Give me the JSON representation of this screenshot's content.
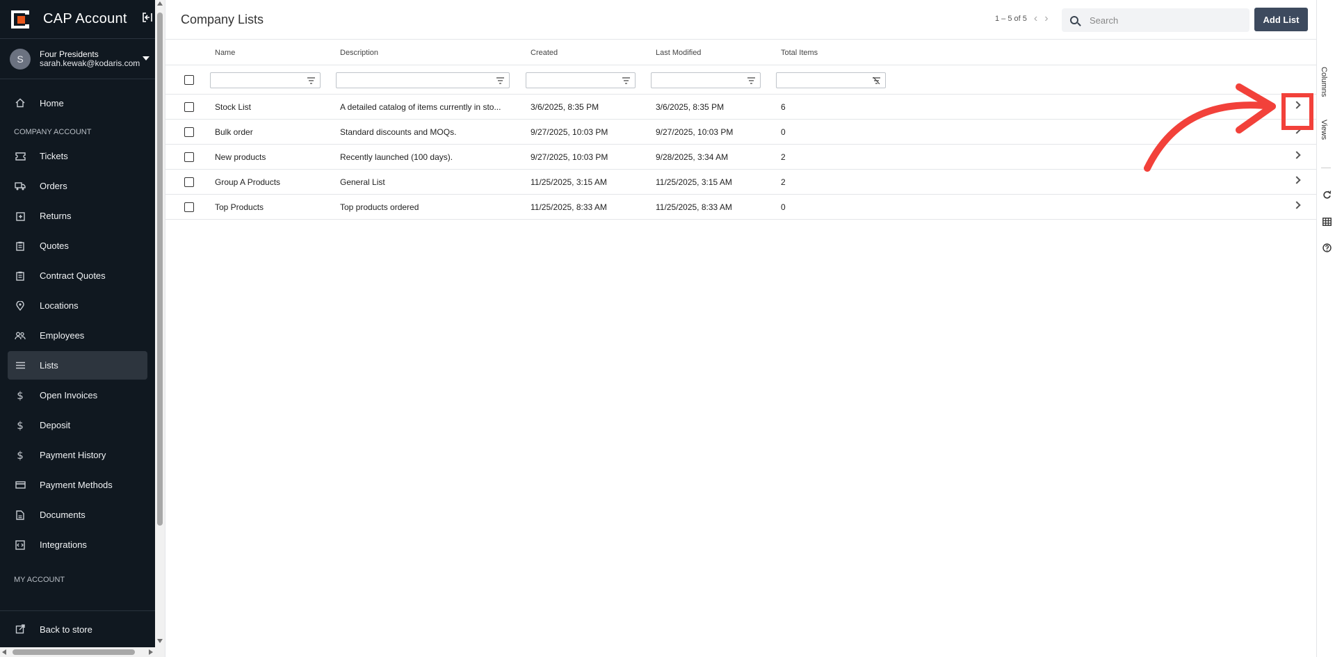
{
  "sidebar": {
    "app_title": "CAP Account",
    "account": {
      "avatar_initial": "S",
      "name": "Four Presidents",
      "email": "sarah.kewak@kodaris.com"
    },
    "home_label": "Home",
    "section_company": "COMPANY ACCOUNT",
    "items": [
      {
        "label": "Tickets",
        "icon": "ticket-icon"
      },
      {
        "label": "Orders",
        "icon": "truck-icon"
      },
      {
        "label": "Returns",
        "icon": "return-box-icon"
      },
      {
        "label": "Quotes",
        "icon": "clipboard-icon"
      },
      {
        "label": "Contract Quotes",
        "icon": "clipboard-icon"
      },
      {
        "label": "Locations",
        "icon": "location-pin-icon"
      },
      {
        "label": "Employees",
        "icon": "people-icon"
      },
      {
        "label": "Lists",
        "icon": "list-icon",
        "active": true
      },
      {
        "label": "Open Invoices",
        "icon": "dollar-icon"
      },
      {
        "label": "Deposit",
        "icon": "dollar-icon"
      },
      {
        "label": "Payment History",
        "icon": "dollar-icon"
      },
      {
        "label": "Payment Methods",
        "icon": "credit-card-icon"
      },
      {
        "label": "Documents",
        "icon": "document-icon"
      },
      {
        "label": "Integrations",
        "icon": "integration-icon"
      }
    ],
    "section_my_account": "MY ACCOUNT",
    "back_to_store": "Back to store"
  },
  "header": {
    "title": "Company Lists",
    "pager": "1 – 5 of 5",
    "search_placeholder": "Search",
    "add_button": "Add List"
  },
  "table": {
    "columns": [
      "Name",
      "Description",
      "Created",
      "Last Modified",
      "Total Items"
    ],
    "rows": [
      {
        "name": "Stock List",
        "description": "A detailed catalog of items currently in sto...",
        "created": "3/6/2025, 8:35 PM",
        "modified": "3/6/2025, 8:35 PM",
        "total": "6"
      },
      {
        "name": "Bulk order",
        "description": "Standard discounts and MOQs.",
        "created": "9/27/2025, 10:03 PM",
        "modified": "9/27/2025, 10:03 PM",
        "total": "0"
      },
      {
        "name": "New products",
        "description": "Recently launched (100 days).",
        "created": "9/27/2025, 10:03 PM",
        "modified": "9/28/2025, 3:34 AM",
        "total": "2"
      },
      {
        "name": "Group A Products",
        "description": "General List",
        "created": "11/25/2025, 3:15 AM",
        "modified": "11/25/2025, 3:15 AM",
        "total": "2"
      },
      {
        "name": "Top Products",
        "description": "Top products ordered",
        "created": "11/25/2025, 8:33 AM",
        "modified": "11/25/2025, 8:33 AM",
        "total": "0"
      }
    ]
  },
  "rail": {
    "columns_tab": "Columns",
    "views_tab": "Views"
  },
  "colors": {
    "sidebar_bg": "#101820",
    "accent": "#e8561b",
    "button": "#3d4a5e",
    "annotation": "#f2413a"
  }
}
